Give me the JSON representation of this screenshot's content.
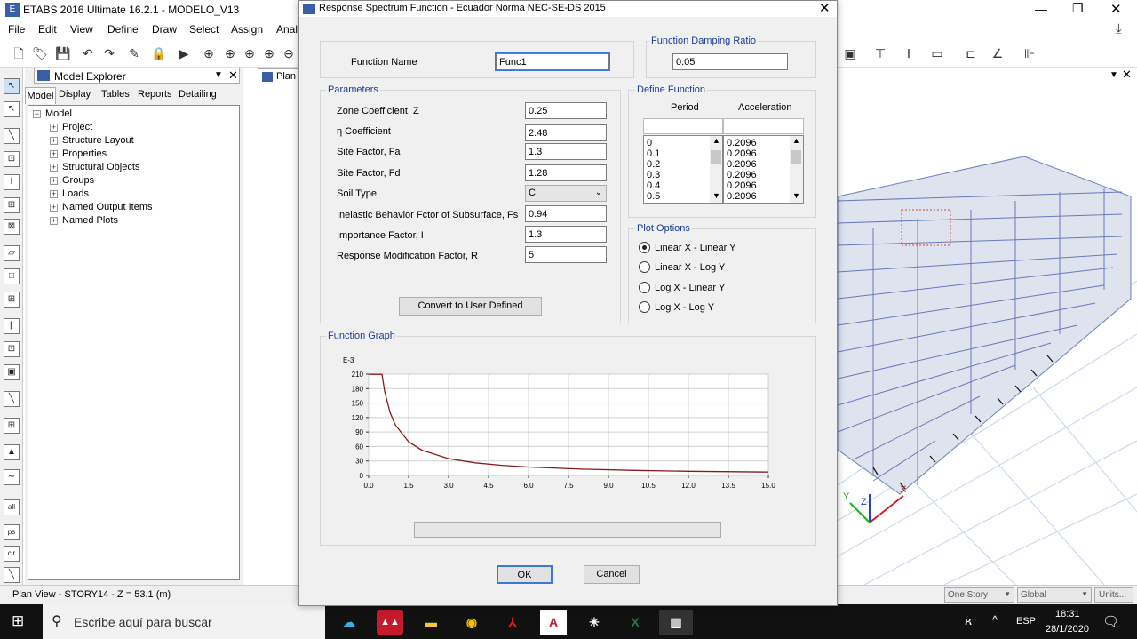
{
  "app": {
    "title": "ETABS 2016 Ultimate 16.2.1 - MODELO_V13"
  },
  "menu": [
    "File",
    "Edit",
    "View",
    "Define",
    "Draw",
    "Select",
    "Assign",
    "Analy"
  ],
  "explorer": {
    "title": "Model Explorer",
    "tabs": [
      "Model",
      "Display",
      "Tables",
      "Reports",
      "Detailing"
    ],
    "root": "Model",
    "items": [
      "Project",
      "Structure Layout",
      "Properties",
      "Structural Objects",
      "Groups",
      "Loads",
      "Named Output Items",
      "Named Plots"
    ]
  },
  "plan_tab": "Plan",
  "status": {
    "text": "Plan View - STORY14 - Z = 53.1 (m)",
    "story": "One Story",
    "global": "Global",
    "units": "Units..."
  },
  "dialog": {
    "title": "Response Spectrum Function - Ecuador Norma NEC-SE-DS 2015",
    "function_name_label": "Function Name",
    "function_name": "Func1",
    "damping_group": "Function Damping Ratio",
    "damping": "0.05",
    "parameters_group": "Parameters",
    "params": [
      {
        "label": "Zone Coefficient, Z",
        "value": "0.25"
      },
      {
        "label": "η Coefficient",
        "value": "2.48"
      },
      {
        "label": "Site Factor, Fa",
        "value": "1.3"
      },
      {
        "label": "Site Factor, Fd",
        "value": "1.28"
      },
      {
        "label": "Soil Type",
        "value": "C"
      },
      {
        "label": "Inelastic Behavior Fctor of Subsurface, Fs",
        "value": "0.94"
      },
      {
        "label": "Importance Factor, I",
        "value": "1.3"
      },
      {
        "label": "Response Modification Factor, R",
        "value": "5"
      }
    ],
    "convert_button": "Convert to User Defined",
    "define_group": "Define Function",
    "period_header": "Period",
    "accel_header": "Acceleration",
    "periods": [
      "0",
      "0.1",
      "0.2",
      "0.3",
      "0.4",
      "0.5"
    ],
    "accels": [
      "0.2096",
      "0.2096",
      "0.2096",
      "0.2096",
      "0.2096",
      "0.2096"
    ],
    "plot_group": "Plot Options",
    "plot_options": [
      "Linear X - Linear Y",
      "Linear X - Log Y",
      "Log X - Linear Y",
      "Log X - Log Y"
    ],
    "graph_group": "Function Graph",
    "ok": "OK",
    "cancel": "Cancel"
  },
  "chart_data": {
    "type": "line",
    "yunit": "E-3",
    "xlim": [
      0,
      15
    ],
    "ylim": [
      0,
      210
    ],
    "xticks": [
      "0.0",
      "1.5",
      "3.0",
      "4.5",
      "6.0",
      "7.5",
      "9.0",
      "10.5",
      "12.0",
      "13.5",
      "15.0"
    ],
    "yticks": [
      "0",
      "30",
      "60",
      "90",
      "120",
      "150",
      "180",
      "210"
    ],
    "series": [
      {
        "color": "#8b1a1a",
        "x": [
          0,
          0.5,
          0.6,
          0.8,
          1.0,
          1.5,
          2.0,
          3.0,
          4.0,
          5.0,
          6.0,
          8.0,
          10.0,
          12.0,
          15.0
        ],
        "y": [
          209.6,
          209.6,
          174.7,
          131,
          104.8,
          69.9,
          52.4,
          34.9,
          26.2,
          21,
          17.5,
          13.1,
          10.5,
          8.7,
          7
        ]
      }
    ]
  },
  "taskbar": {
    "search": "Escribe aquí para buscar",
    "lang": "ESP",
    "time": "18:31",
    "date": "28/1/2020"
  }
}
